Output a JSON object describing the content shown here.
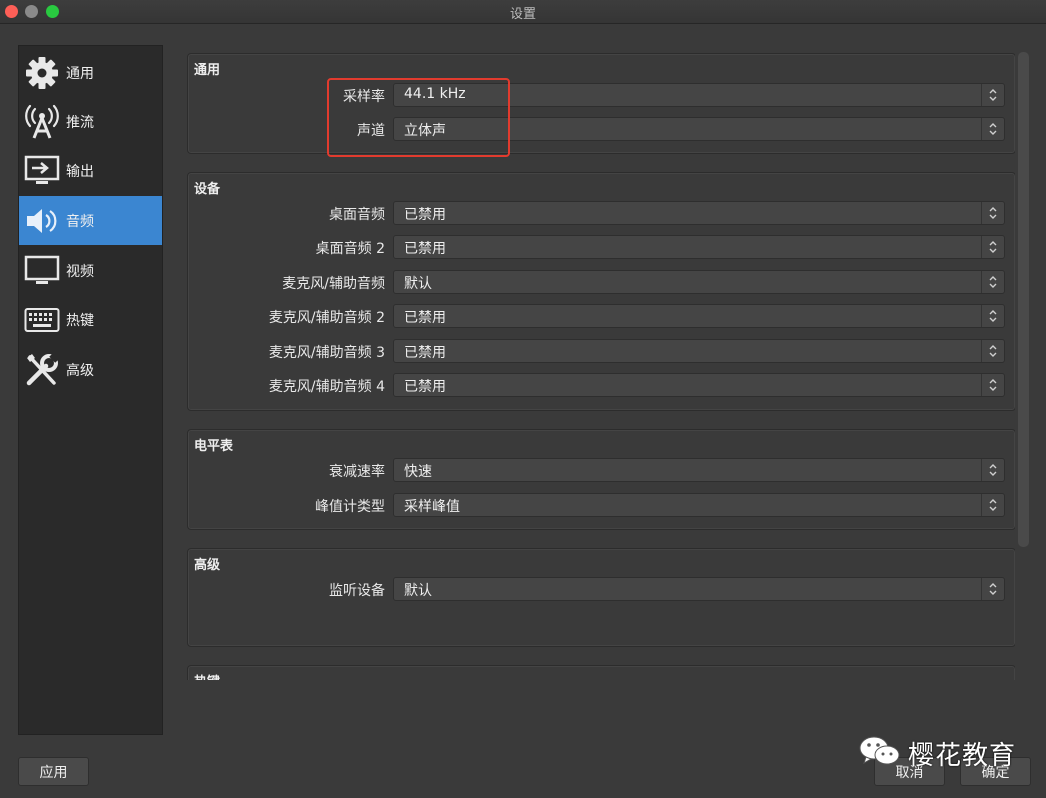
{
  "window": {
    "title": "设置"
  },
  "sidebar": {
    "items": [
      {
        "label": "通用",
        "icon": "gear-icon"
      },
      {
        "label": "推流",
        "icon": "antenna-icon"
      },
      {
        "label": "输出",
        "icon": "output-monitor-icon"
      },
      {
        "label": "音频",
        "icon": "speaker-icon",
        "active": true
      },
      {
        "label": "视频",
        "icon": "monitor-icon"
      },
      {
        "label": "热键",
        "icon": "keyboard-icon"
      },
      {
        "label": "高级",
        "icon": "tools-icon"
      }
    ]
  },
  "groups": {
    "general": {
      "title": "通用",
      "rows": [
        {
          "label": "采样率",
          "value": "44.1 kHz"
        },
        {
          "label": "声道",
          "value": "立体声"
        }
      ]
    },
    "devices": {
      "title": "设备",
      "rows": [
        {
          "label": "桌面音频",
          "value": "已禁用"
        },
        {
          "label": "桌面音频 2",
          "value": "已禁用"
        },
        {
          "label": "麦克风/辅助音频",
          "value": "默认"
        },
        {
          "label": "麦克风/辅助音频 2",
          "value": "已禁用"
        },
        {
          "label": "麦克风/辅助音频 3",
          "value": "已禁用"
        },
        {
          "label": "麦克风/辅助音频 4",
          "value": "已禁用"
        }
      ]
    },
    "meters": {
      "title": "电平表",
      "rows": [
        {
          "label": "衰减速率",
          "value": "快速"
        },
        {
          "label": "峰值计类型",
          "value": "采样峰值"
        }
      ]
    },
    "advanced": {
      "title": "高级",
      "rows": [
        {
          "label": "监听设备",
          "value": "默认"
        }
      ]
    },
    "hotkeys": {
      "title": "热键"
    }
  },
  "buttons": {
    "apply": "应用",
    "cancel": "取消",
    "ok": "确定"
  },
  "watermark": {
    "text": "樱花教育"
  },
  "colors": {
    "accent": "#3b86d1",
    "highlight": "#e23b2e",
    "background": "#3a3a3a",
    "sidebar": "#2a2a2a"
  }
}
